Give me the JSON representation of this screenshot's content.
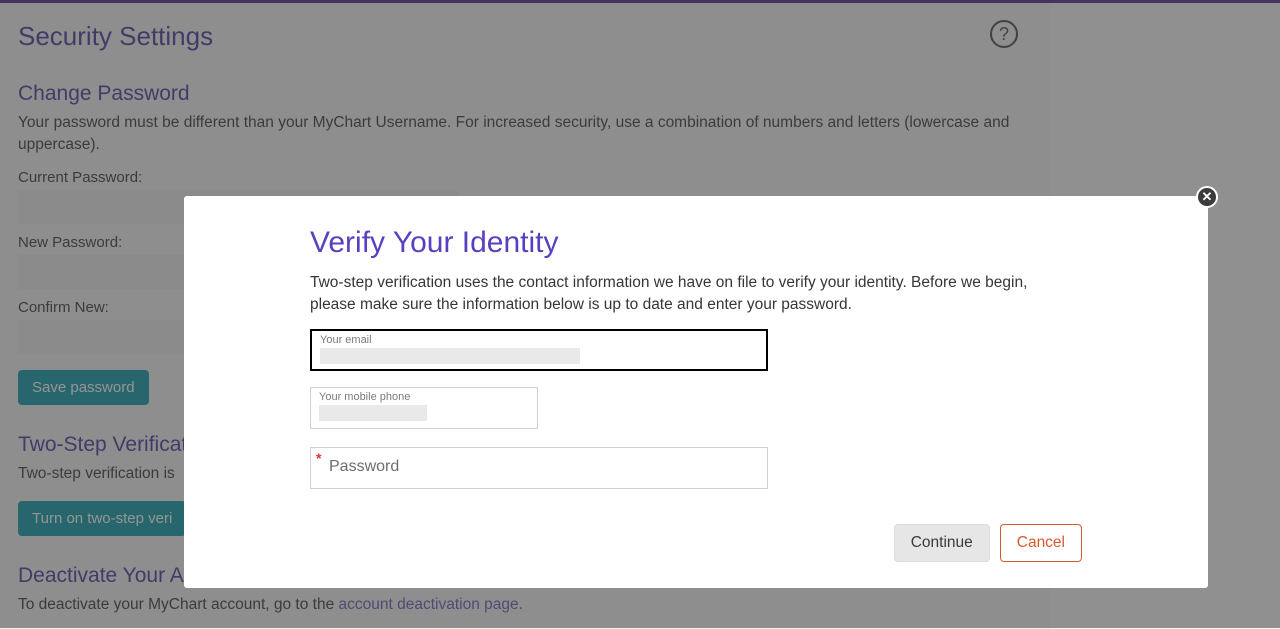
{
  "page": {
    "title": "Security Settings",
    "help_tooltip": "?"
  },
  "change_password": {
    "heading": "Change Password",
    "desc": "Your password must be different than your MyChart Username. For increased security, use a combination of numbers and letters (lowercase and uppercase).",
    "current_label": "Current Password:",
    "new_label": "New Password:",
    "confirm_label": "Confirm New:",
    "save_button": "Save password"
  },
  "two_step": {
    "heading": "Two-Step Verificati",
    "desc": "Two-step verification is",
    "turn_on_button": "Turn on two-step veri"
  },
  "deactivate": {
    "heading": "Deactivate Your Account",
    "desc_prefix": "To deactivate your MyChart account, go to the ",
    "link_text": "account deactivation page."
  },
  "modal": {
    "title": "Verify Your Identity",
    "desc": "Two-step verification uses the contact information we have on file to verify your identity. Before we begin, please make sure the information below is up to date and enter your password.",
    "email_label": "Your email",
    "phone_label": "Your mobile phone",
    "password_placeholder": "Password",
    "continue_button": "Continue",
    "cancel_button": "Cancel"
  }
}
